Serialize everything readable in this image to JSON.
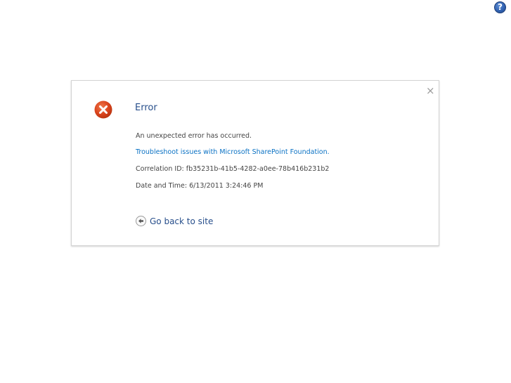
{
  "header": {
    "help_icon_glyph": "?",
    "help_icon": "help-icon"
  },
  "dialog": {
    "close_glyph": "×",
    "close_icon": "close-icon",
    "error_icon": "error-x-icon",
    "title": "Error",
    "message": "An unexpected error has occurred.",
    "troubleshoot_link": "Troubleshoot issues with Microsoft SharePoint Foundation.",
    "correlation": "Correlation ID: fb35231b-41b5-4282-a0ee-78b416b231b2",
    "date_time": "Date and Time: 6/13/2011 3:24:46 PM",
    "back_link": "Go back to site",
    "back_icon": "back-arrow-icon"
  },
  "colors": {
    "accent_title": "#274e8b",
    "link": "#0b72c4",
    "error_red": "#d9431c",
    "help_blue": "#2f5fae"
  }
}
